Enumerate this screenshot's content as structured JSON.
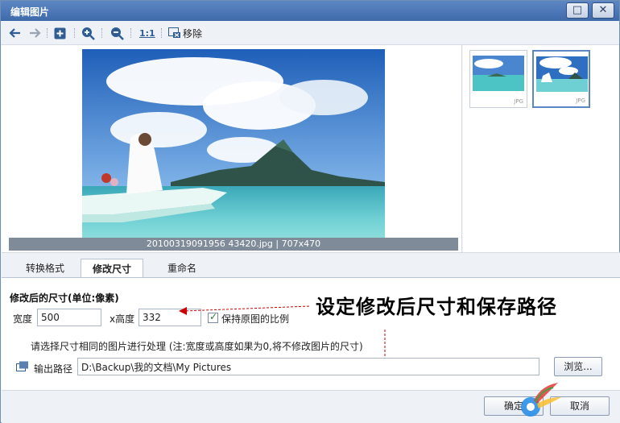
{
  "window": {
    "title": "编辑图片",
    "maximize_glyph": "□",
    "close_glyph": "✕"
  },
  "toolbar": {
    "back_icon": "arrow-left-icon",
    "forward_icon": "arrow-right-icon",
    "add_icon": "plus-icon",
    "zoom_in_icon": "zoom-in-icon",
    "zoom_out_icon": "zoom-out-icon",
    "ratio_label": "1:1",
    "remove_label": "移除"
  },
  "preview": {
    "caption": "20100319091956 43420.jpg | 707x470"
  },
  "thumbnails": [
    {
      "badge": "JPG"
    },
    {
      "badge": "JPG"
    }
  ],
  "tabs": [
    {
      "label": "转换格式"
    },
    {
      "label": "修改尺寸"
    },
    {
      "label": "重命名"
    }
  ],
  "resize": {
    "section_title": "修改后的尺寸(单位:像素)",
    "width_label": "宽度",
    "width_value": "500",
    "height_label": "x高度",
    "height_value": "332",
    "keep_ratio_label": "保持原图的比例",
    "note": "请选择尺寸相同的图片进行处理 (注:宽度或高度如果为0,将不修改图片的尺寸)",
    "output_label": "输出路径",
    "output_value": "D:\\Backup\\我的文档\\My Pictures",
    "browse_label": "浏览..."
  },
  "annotation": "设定修改后尺寸和保存路径",
  "footer": {
    "ok_label": "确定",
    "cancel_label": "取消"
  },
  "colors": {
    "accent": "#3f6aaa",
    "annotation_arrow": "#cc0000"
  }
}
